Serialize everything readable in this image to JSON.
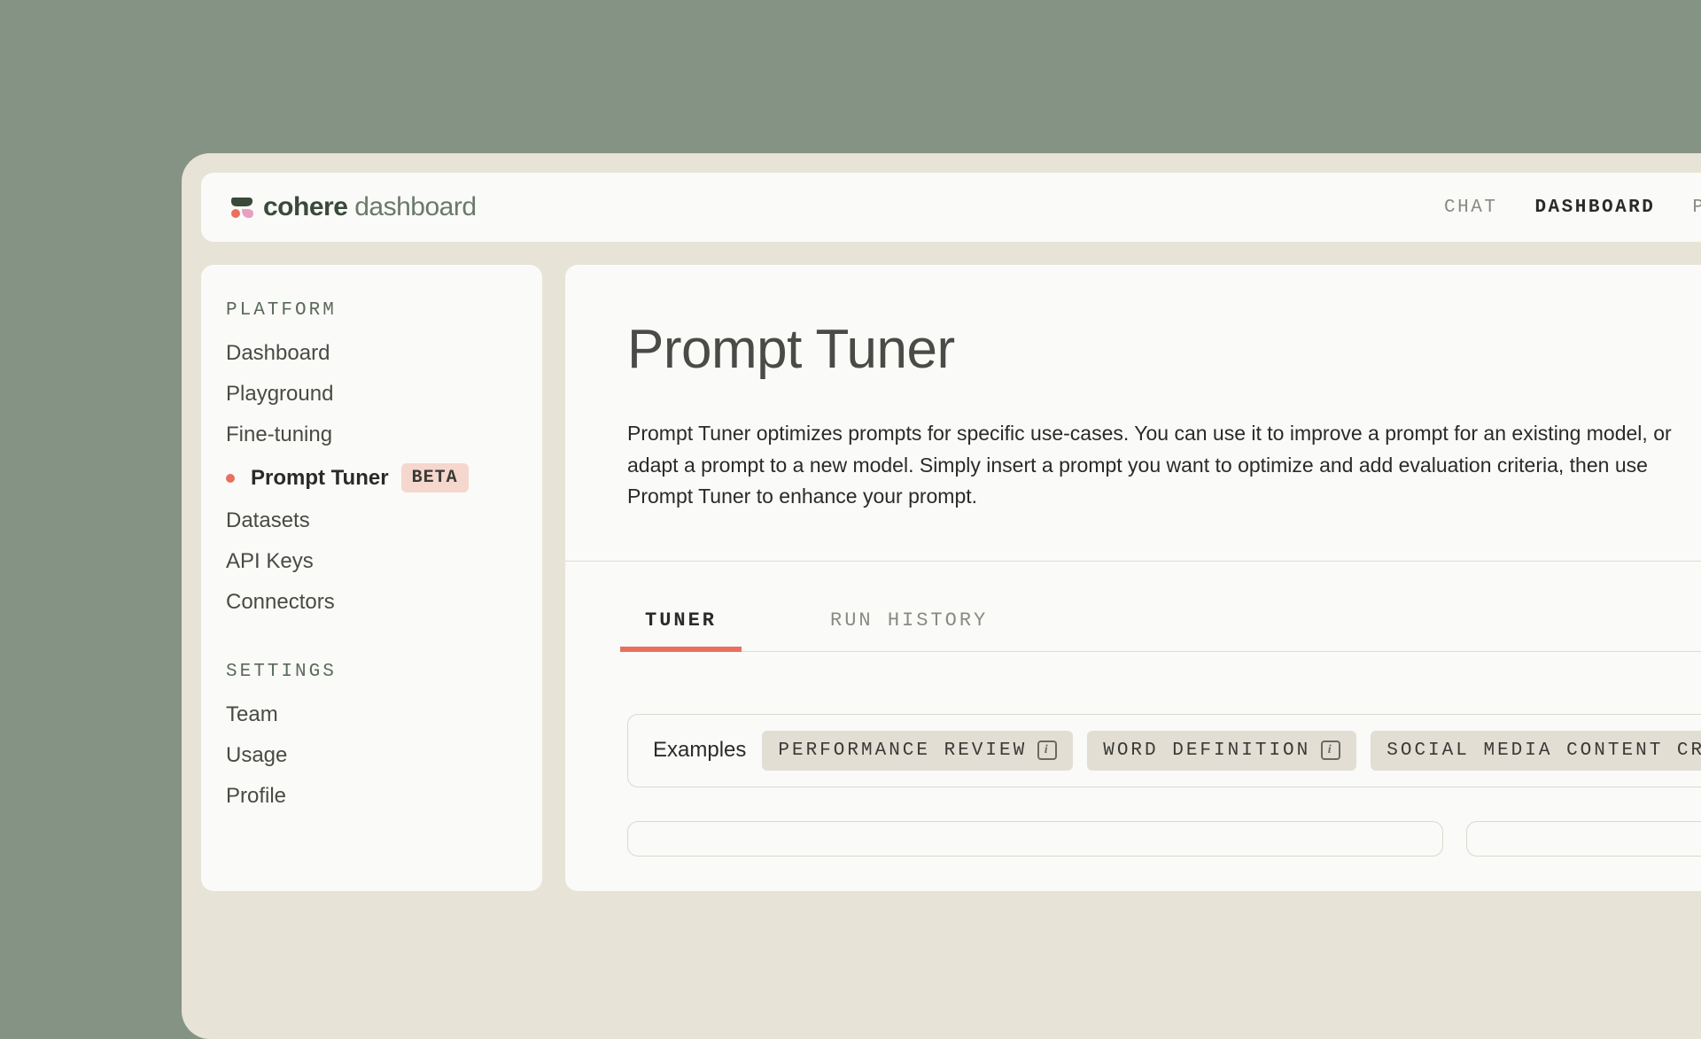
{
  "header": {
    "brand_name": "cohere",
    "brand_suffix": "dashboard",
    "nav": [
      {
        "label": "CHAT",
        "active": false
      },
      {
        "label": "DASHBOARD",
        "active": true
      },
      {
        "label": "PLAYGR",
        "active": false
      }
    ]
  },
  "sidebar": {
    "sections": [
      {
        "title": "PLATFORM",
        "items": [
          {
            "label": "Dashboard",
            "active": false,
            "badge": null
          },
          {
            "label": "Playground",
            "active": false,
            "badge": null
          },
          {
            "label": "Fine-tuning",
            "active": false,
            "badge": null
          },
          {
            "label": "Prompt Tuner",
            "active": true,
            "badge": "BETA"
          },
          {
            "label": "Datasets",
            "active": false,
            "badge": null
          },
          {
            "label": "API Keys",
            "active": false,
            "badge": null
          },
          {
            "label": "Connectors",
            "active": false,
            "badge": null
          }
        ]
      },
      {
        "title": "SETTINGS",
        "items": [
          {
            "label": "Team",
            "active": false,
            "badge": null
          },
          {
            "label": "Usage",
            "active": false,
            "badge": null
          },
          {
            "label": "Profile",
            "active": false,
            "badge": null
          }
        ]
      }
    ]
  },
  "main": {
    "title": "Prompt Tuner",
    "description": "Prompt Tuner optimizes prompts for specific use-cases. You can use it to improve a prompt for an existing model, or adapt a prompt to a new model. Simply insert a prompt you want to optimize and add evaluation criteria, then use Prompt Tuner to enhance your prompt.",
    "tabs": [
      {
        "label": "TUNER",
        "active": true
      },
      {
        "label": "RUN HISTORY",
        "active": false
      }
    ],
    "examples_label": "Examples",
    "example_chips": [
      {
        "label": "PERFORMANCE REVIEW",
        "info": true
      },
      {
        "label": "WORD DEFINITION",
        "info": true
      },
      {
        "label": "SOCIAL MEDIA CONTENT CRE",
        "info": false
      }
    ]
  },
  "colors": {
    "accent": "#e8705f",
    "badge_bg": "#f5d7cd",
    "chip_bg": "#e2ded4"
  }
}
